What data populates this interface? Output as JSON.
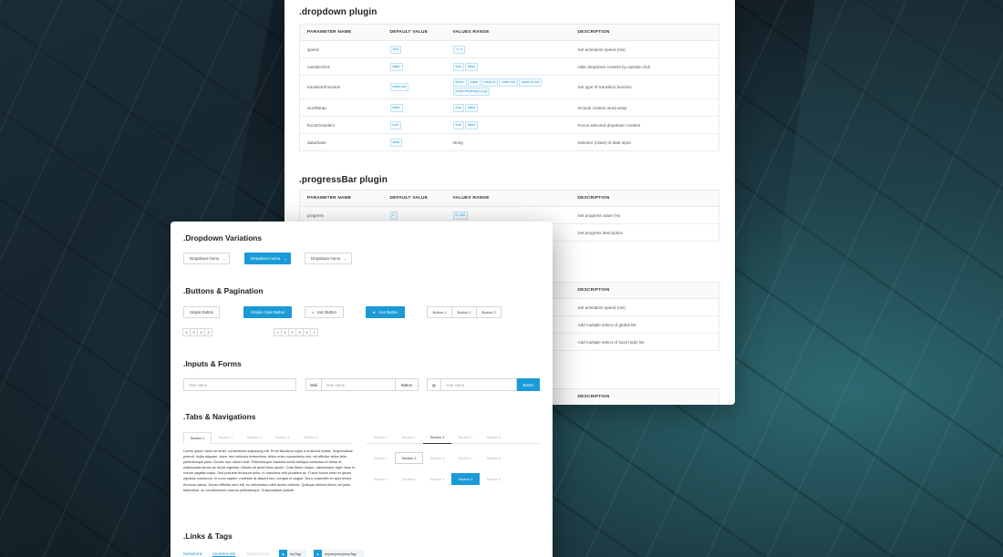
{
  "dropdown_plugin": {
    "title": ".dropdown plugin",
    "headers": [
      "PARAMETER NAME",
      "DEFAULT VALUE",
      "VALUES RANGE",
      "DESCRIPTION"
    ],
    "rows": [
      {
        "name": "speed",
        "default": "300",
        "range": [
          ">= 0"
        ],
        "range_plain": "",
        "desc": "Set animation speed (ms)"
      },
      {
        "name": "outsideClick",
        "default": "false",
        "range": [
          "true",
          "false"
        ],
        "range_plain": "",
        "desc": "Hide dropdown content by outside click"
      },
      {
        "name": "transitionFunction",
        "default": "ease-out",
        "range": [
          "linear",
          "ease",
          "ease-in",
          "ease-out",
          "ease-in-out",
          "cubic-bezier(a,p,p,p)"
        ],
        "range_plain": "",
        "desc": "Set type of transition function"
      },
      {
        "name": "wordWrap",
        "default": "false",
        "range": [
          "true",
          "false"
        ],
        "range_plain": "",
        "desc": "Include content word wrap"
      },
      {
        "name": "focusOnSelect",
        "default": "true",
        "range": [
          "true",
          "false"
        ],
        "range_plain": "",
        "desc": "Focus selected dropdown content"
      },
      {
        "name": "dataClass",
        "default": "data",
        "range": [],
        "range_plain": "string",
        "desc": "Selector (class) of data input"
      }
    ]
  },
  "progress_plugin": {
    "title": ".progressBar plugin",
    "headers": [
      "PARAMETER NAME",
      "DEFAULT VALUE",
      "VALUES RANGE",
      "DESCRIPTION"
    ],
    "rows": [
      {
        "name": "progress",
        "default": "0",
        "range": [
          "0..100"
        ],
        "desc": "Set progress value (%)"
      },
      {
        "name": "",
        "default": "",
        "range": [],
        "desc": "Set progress description"
      }
    ]
  },
  "third_plugin": {
    "header_desc": "DESCRIPTION",
    "rows": [
      "Set animation speed (ms)",
      "Add multiple select of global list",
      "Add multiple select of local (sub) list"
    ]
  },
  "fourth_plugin": {
    "header_desc": "DESCRIPTION"
  },
  "front": {
    "dropdown_title": ".Dropdown Variations",
    "dropdowns": [
      "Dropdown menu",
      "Dropdown menu",
      "Dropdown menu"
    ],
    "buttons_title": ".Buttons & Pagination",
    "simple_button": "Simple Button",
    "color_button": "Simple Color Button",
    "icon_button": "Icon Button",
    "icon_button_color": "Icon Button",
    "group": [
      "Button 1",
      "Button 2",
      "Button 3"
    ],
    "pager1": [
      "1",
      "2",
      "3",
      "4"
    ],
    "pager2": [
      "«",
      "1",
      "2",
      "3",
      "4",
      "»"
    ],
    "inputs_title": ".Inputs & Forms",
    "input_placeholder": "Your name",
    "mail_label": "Mail",
    "input2_placeholder": "Your name",
    "button_label": "Button",
    "input3_placeholder": "Your name",
    "button_primary": "Button",
    "tabs_title": ".Tabs & Navigations",
    "tabs": [
      "Section 1",
      "Section 2",
      "Section 3",
      "Section 4",
      "Section 5"
    ],
    "lorem": "Lorem ipsum dolor sit amet, consectetur adipiscing elit. Proin faucibus turpis a euismod mattis. Suspendisse potenti. Nulla aliquam, tortor nec vehicula fermentum, tellus enim consectetur nisl, vel efficitur tellus felis pellentesque justo. Donec non rutrum erat. Pellentesque habitant morbi tristique senectus et netus et malesuada fames ac turpis egestas. Mauris sit amet risus ipsum. Cras libero neque, ullamcorper eget risus in, rutrum sagittis turpis. Sed posuere tincidunt dolor, in maximus velit pharetra ac. Fusce luctus enim et ipsum egestas commodo. In nunc sapien, molestie at aliquet nec, congue et augue. Nunc imperdiet ex quis lectus rhoncus varius. Donec efficitur sem elit, eu elementum nibh auctor ultrices. Quisque ultrices libero vel justo bibendum, ac condimentum mauris pellentesque. Suspendisse potenti.",
    "links_title": ".Links & Tags",
    "links": [
      "Default link",
      "Underline link",
      "Disabled link"
    ],
    "tags": [
      "myTag",
      "myveryveryveryTag"
    ]
  }
}
